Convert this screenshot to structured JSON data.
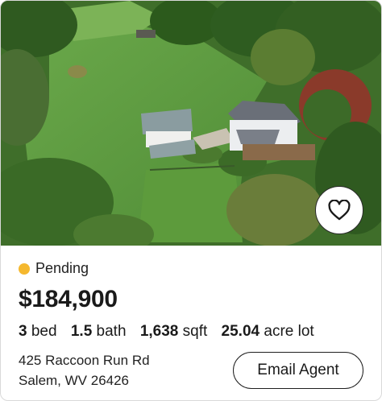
{
  "listing": {
    "status": "Pending",
    "status_color": "#f5b82e",
    "price": "$184,900",
    "beds_value": "3",
    "beds_unit": "bed",
    "baths_value": "1.5",
    "baths_unit": "bath",
    "sqft_value": "1,638",
    "sqft_unit": "sqft",
    "lot_value": "25.04",
    "lot_unit": "acre lot",
    "address_line1": "425 Raccoon Run Rd",
    "address_line2": "Salem, WV 26426",
    "email_agent_label": "Email Agent",
    "favorite_icon": "heart-outline-icon"
  }
}
